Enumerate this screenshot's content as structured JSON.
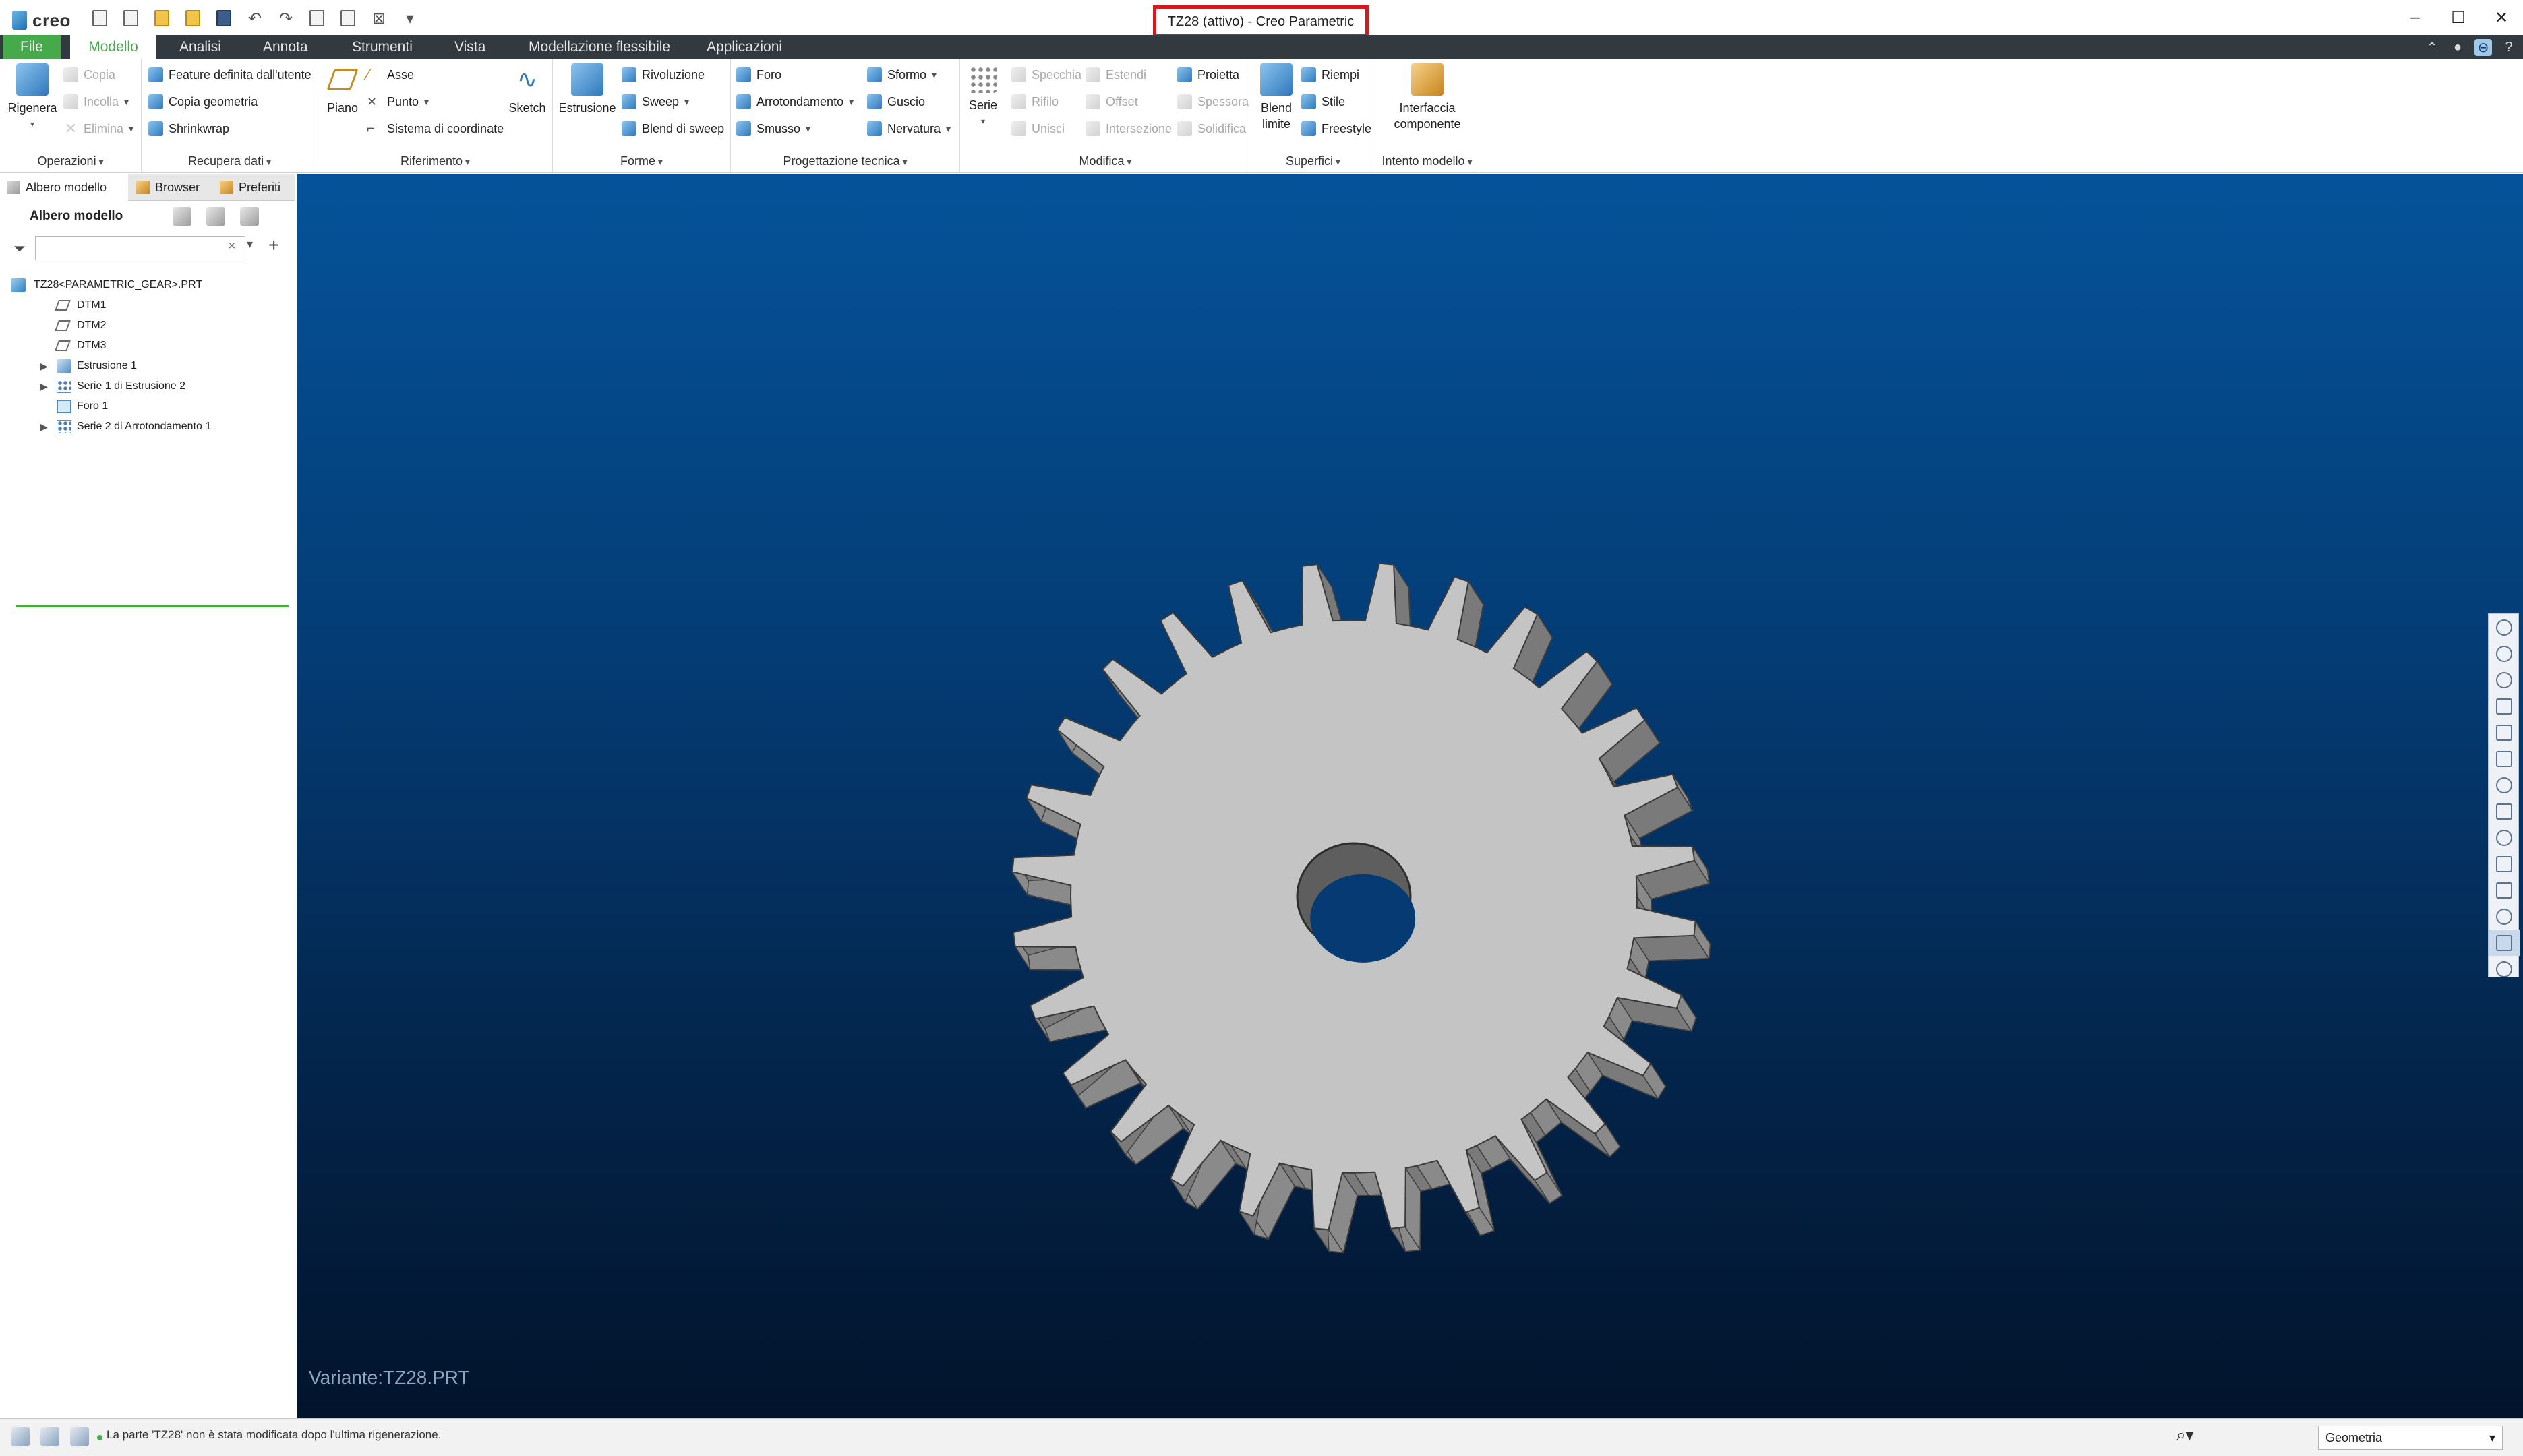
{
  "app": {
    "logo_text": "creo",
    "window_title": "TZ28 (attivo) - Creo Parametric"
  },
  "window_controls": {
    "minimize": "–",
    "maximize": "☐",
    "close": "✕"
  },
  "menu": {
    "file": "File",
    "tabs": [
      "Modello",
      "Analisi",
      "Annota",
      "Strumenti",
      "Vista",
      "Modellazione flessibile",
      "Applicazioni"
    ],
    "active_tab": "Modello",
    "accent_color": "#46a94a"
  },
  "ribbon": {
    "operazioni": {
      "label": "Operazioni",
      "rigenera": "Rigenera",
      "copia": "Copia",
      "incolla": "Incolla",
      "elimina": "Elimina"
    },
    "recupera": {
      "label": "Recupera dati",
      "feature_utente": "Feature definita dall'utente",
      "copia_geometria": "Copia geometria",
      "shrinkwrap": "Shrinkwrap"
    },
    "riferimento": {
      "label": "Riferimento",
      "piano": "Piano",
      "asse": "Asse",
      "punto": "Punto",
      "sistema": "Sistema di coordinate",
      "sketch": "Sketch"
    },
    "forme": {
      "label": "Forme",
      "estrusione": "Estrusione",
      "rivoluzione": "Rivoluzione",
      "sweep": "Sweep",
      "blend_sweep": "Blend di sweep"
    },
    "progettazione": {
      "label": "Progettazione tecnica",
      "foro": "Foro",
      "arrotondamento": "Arrotondamento",
      "smusso": "Smusso",
      "sformo": "Sformo",
      "guscio": "Guscio",
      "nervatura": "Nervatura"
    },
    "modifica": {
      "label": "Modifica",
      "serie": "Serie",
      "specchia": "Specchia",
      "rifilo": "Rifilo",
      "unisci": "Unisci",
      "estendi": "Estendi",
      "offset": "Offset",
      "intersezione": "Intersezione",
      "proietta": "Proietta",
      "spessora": "Spessora",
      "solidifica": "Solidifica"
    },
    "superfici": {
      "label": "Superfici",
      "blend_limite_1": "Blend",
      "blend_limite_2": "limite",
      "riempi": "Riempi",
      "stile": "Stile",
      "freestyle": "Freestyle"
    },
    "intento": {
      "label": "Intento modello",
      "interfaccia_1": "Interfaccia",
      "interfaccia_2": "componente"
    }
  },
  "panel": {
    "tabs": [
      "Albero modello",
      "Browser",
      "Preferiti"
    ],
    "tree_title": "Albero modello",
    "search_placeholder": "",
    "tree": [
      {
        "label": "TZ28<PARAMETRIC_GEAR>.PRT",
        "icon": "part-icon",
        "indent": 0,
        "expandable": false
      },
      {
        "label": "DTM1",
        "icon": "datum-plane-icon",
        "indent": 1,
        "expandable": false
      },
      {
        "label": "DTM2",
        "icon": "datum-plane-icon",
        "indent": 1,
        "expandable": false
      },
      {
        "label": "DTM3",
        "icon": "datum-plane-icon",
        "indent": 1,
        "expandable": false
      },
      {
        "label": "Estrusione 1",
        "icon": "extrude-icon",
        "indent": 1,
        "expandable": true
      },
      {
        "label": "Serie 1 di Estrusione 2",
        "icon": "pattern-icon",
        "indent": 1,
        "expandable": true
      },
      {
        "label": "Foro 1",
        "icon": "hole-icon",
        "indent": 1,
        "expandable": false
      },
      {
        "label": "Serie 2 di Arrotondamento 1",
        "icon": "pattern-icon",
        "indent": 1,
        "expandable": true
      }
    ]
  },
  "viewport": {
    "variant_label": "Variante:TZ28.PRT",
    "model": {
      "teeth": 28,
      "body_color": "#c4c4c4",
      "flank_color": "#8a8a8a"
    }
  },
  "status": {
    "message": "La parte 'TZ28' non è stata modificata dopo l'ultima rigenerazione.",
    "filter_value": "Geometria"
  }
}
